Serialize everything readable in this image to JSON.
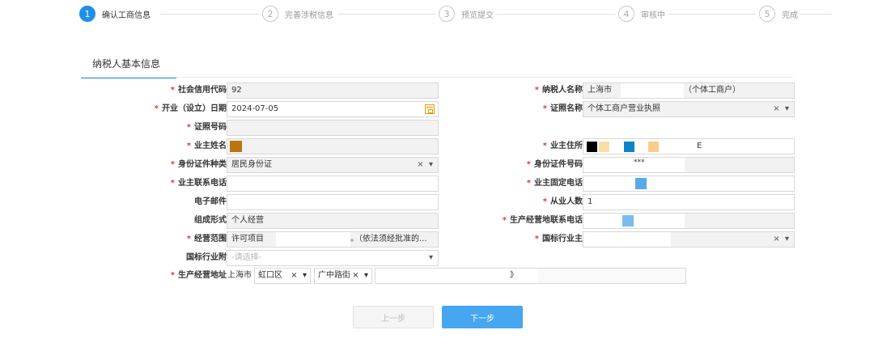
{
  "stepper": {
    "steps": [
      {
        "num": "1",
        "label": "确认工商信息"
      },
      {
        "num": "2",
        "label": "完善涉税信息"
      },
      {
        "num": "3",
        "label": "预览提交"
      },
      {
        "num": "4",
        "label": "审核中"
      },
      {
        "num": "5",
        "label": "完成"
      }
    ],
    "active_index": 0
  },
  "section_title": "纳税人基本信息",
  "left_fields": {
    "credit_code": {
      "label": "社会信用代码",
      "value": "92"
    },
    "open_date": {
      "label": "开业（设立）日期",
      "value": "2024-07-05"
    },
    "license_no": {
      "label": "证照号码",
      "value": ""
    },
    "owner_name": {
      "label": "业主姓名",
      "value": ""
    },
    "id_type": {
      "label": "身份证件种类",
      "value": "居民身份证"
    },
    "owner_phone": {
      "label": "业主联系电话",
      "value": ""
    },
    "email": {
      "label": "电子邮件",
      "value": ""
    },
    "org_form": {
      "label": "组成形式",
      "value": "个人经营"
    },
    "business_scope": {
      "label": "经营范围",
      "value": "许可项目",
      "value_tail": "。（依法须经批准的..."
    },
    "industry_sub": {
      "label": "国标行业附",
      "placeholder": "-请选择-"
    },
    "address": {
      "label": "生产经营地址",
      "city": "上海市",
      "district": "虹口区",
      "street": "广中路街",
      "tail": "》"
    }
  },
  "right_fields": {
    "taxpayer_name": {
      "label": "纳税人名称",
      "value": "上海市",
      "suffix": "（个体工商户）"
    },
    "license_name": {
      "label": "证照名称",
      "value": "个体工商户营业执照"
    },
    "owner_address": {
      "label": "业主住所",
      "value_tail": "E"
    },
    "id_number": {
      "label": "身份证件号码",
      "value": "***"
    },
    "owner_landline": {
      "label": "业主固定电话",
      "value": ""
    },
    "employees": {
      "label": "从业人数",
      "value": "1"
    },
    "business_phone": {
      "label": "生产经营地联系电话",
      "value": ""
    },
    "industry_main": {
      "label": "国标行业主",
      "value": ""
    }
  },
  "controls": {
    "clear": "×",
    "dropdown": "▾"
  },
  "buttons": {
    "prev": "上一步",
    "next": "下一步"
  },
  "colors": {
    "accent": "#1e8ee8",
    "required": "#e23a3a",
    "next_button": "#46a6f0"
  },
  "swatches": {
    "owner_name": "#b8760e",
    "owner_address": [
      "#000000",
      "#f9dfa6",
      "#0e83c8",
      "#fbcb8a"
    ],
    "owner_landline": "#5aa9e6",
    "business_phone": "#7bbcf0"
  }
}
